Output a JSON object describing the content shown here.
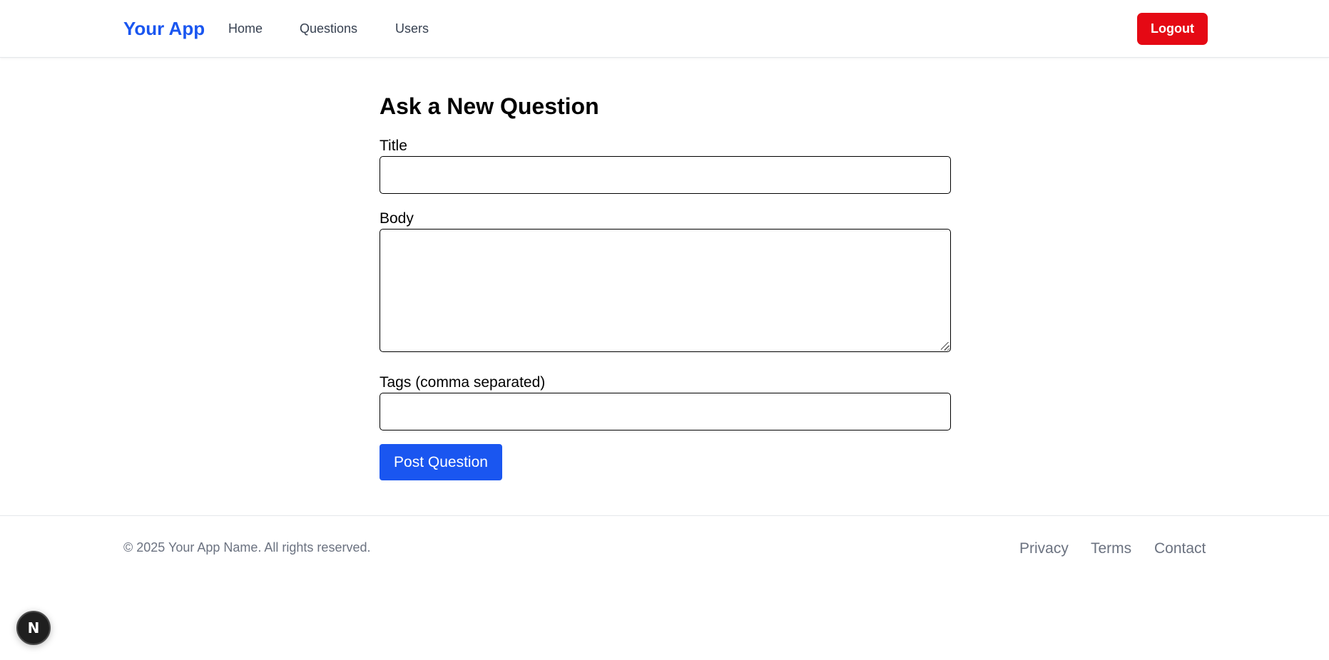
{
  "header": {
    "brand": "Your App",
    "nav": {
      "home": "Home",
      "questions": "Questions",
      "users": "Users"
    },
    "logout_label": "Logout",
    "colors": {
      "brand": "#1a56f0",
      "logout_bg": "#e50914"
    }
  },
  "form": {
    "heading": "Ask a New Question",
    "title_label": "Title",
    "title_value": "",
    "body_label": "Body",
    "body_value": "",
    "tags_label": "Tags (comma separated)",
    "tags_value": "",
    "submit_label": "Post Question",
    "colors": {
      "submit_bg": "#1a56f0"
    }
  },
  "footer": {
    "copyright": "© 2025 Your App Name. All rights reserved.",
    "links": {
      "privacy": "Privacy",
      "terms": "Terms",
      "contact": "Contact"
    }
  },
  "dev_badge": {
    "letter": "N",
    "icon": "nextjs-icon"
  }
}
